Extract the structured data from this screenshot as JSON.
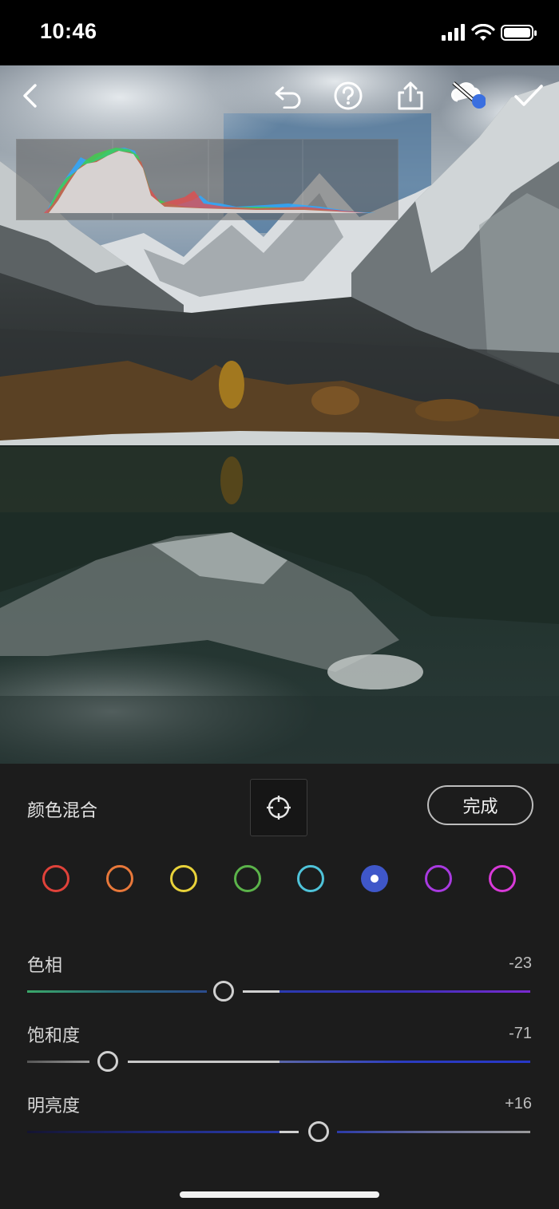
{
  "status_bar": {
    "time": "10:46"
  },
  "toolbar": {
    "icons": [
      "back-icon",
      "undo-icon",
      "help-icon",
      "share-icon",
      "cloud-sync-icon",
      "check-icon"
    ]
  },
  "panel": {
    "title": "颜色混合",
    "done_label": "完成",
    "target_icon": "target-adjust-icon"
  },
  "colors": [
    {
      "name": "red",
      "hex": "#e0423a",
      "selected": false
    },
    {
      "name": "orange",
      "hex": "#e8783a",
      "selected": false
    },
    {
      "name": "yellow",
      "hex": "#e8d23a",
      "selected": false
    },
    {
      "name": "green",
      "hex": "#5bb34a",
      "selected": false
    },
    {
      "name": "aqua",
      "hex": "#4fc3d9",
      "selected": false
    },
    {
      "name": "blue",
      "hex": "#3f57c9",
      "selected": true
    },
    {
      "name": "purple",
      "hex": "#a83ae0",
      "selected": false
    },
    {
      "name": "magenta",
      "hex": "#d83ad8",
      "selected": false
    }
  ],
  "sliders": [
    {
      "label": "色相",
      "value": "-23",
      "position": 0.39
    },
    {
      "label": "饱和度",
      "value": "-71",
      "position": 0.16
    },
    {
      "label": "明亮度",
      "value": "+16",
      "position": 0.58
    }
  ]
}
